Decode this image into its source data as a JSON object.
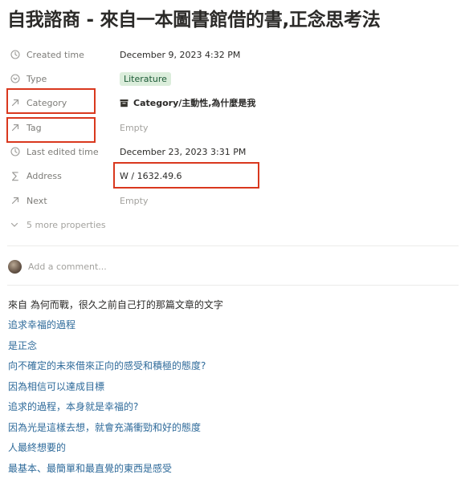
{
  "page": {
    "title": "自我諮商 - 來自一本圖書館借的書,正念思考法"
  },
  "properties": {
    "created_time": {
      "label": "Created time",
      "value": "December 9, 2023 4:32 PM",
      "icon": "clock-icon"
    },
    "type": {
      "label": "Type",
      "value": "Literature",
      "icon": "select-icon",
      "color": "#dbeddb"
    },
    "category": {
      "label": "Category",
      "value": "Category/主動性,為什麼是我",
      "icon": "relation-arrow-icon"
    },
    "tag": {
      "label": "Tag",
      "value": "Empty",
      "icon": "relation-arrow-icon"
    },
    "last_edited": {
      "label": "Last edited time",
      "value": "December 23, 2023 3:31 PM",
      "icon": "clock-icon"
    },
    "address": {
      "label": "Address",
      "value": "W / 1632.49.6",
      "icon": "sigma-icon"
    },
    "next": {
      "label": "Next",
      "value": "Empty",
      "icon": "relation-arrow-icon"
    }
  },
  "more_properties": "5 more properties",
  "comment": {
    "placeholder": "Add a comment..."
  },
  "body": {
    "lines": [
      "來自 為何而戰，很久之前自己打的那篇文章的文字",
      "追求幸福的過程",
      "是正念",
      "向不確定的未來借來正向的感受和積極的態度?",
      "因為相信可以達成目標",
      "追求的過程，本身就是幸福的?",
      "因為光是這樣去想，就會充滿衝勁和好的態度",
      "人最終想要的",
      "最基本、最簡單和最直覺的東西是感受"
    ]
  },
  "highlight_color": "#d9381e",
  "link_color": "#2e6a9a"
}
